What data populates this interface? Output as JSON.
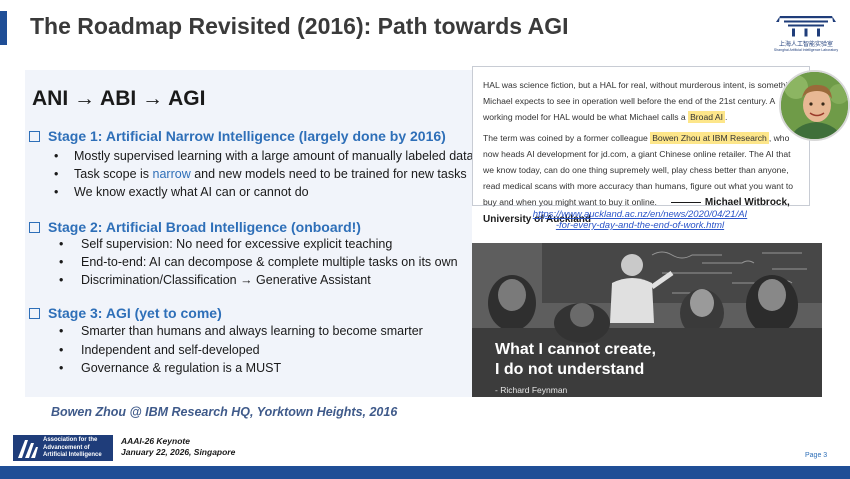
{
  "slide": {
    "title": "The Roadmap Revisited (2016): Path towards AGI",
    "page_label": "Page 3"
  },
  "logo_top_right": {
    "cn_text": "上海人工智能实验室",
    "en_text": "Shanghai Artificial Intelligence Laboratory"
  },
  "main": {
    "heading": "ANI → ABI → AGI",
    "stages": [
      {
        "title": "Stage 1: Artificial Narrow Intelligence (largely done by 2016)",
        "bullets": [
          "Mostly supervised learning with a large amount of manually labeled data",
          "Task scope is narrow and new models need to be trained for new tasks",
          "We know exactly what AI can or cannot do"
        ],
        "bullet2_parts": {
          "before": "Task scope is ",
          "highlight": "narrow",
          "after": " and new models need to be trained for new tasks"
        }
      },
      {
        "title": "Stage 2: Artificial Broad Intelligence (onboard!)",
        "bullets": [
          "Self supervision: No need for excessive explicit teaching",
          "End-to-end: AI can decompose & complete multiple tasks on its own",
          "Discrimination/Classification → Generative Assistant"
        ]
      },
      {
        "title": "Stage 3: AGI (yet to come)",
        "bullets": [
          "Smarter than humans and always learning to become smarter",
          "Independent and self-developed",
          "Governance & regulation is a MUST"
        ]
      }
    ]
  },
  "quote": {
    "p1_a": "HAL was science fiction, but a HAL for real, without murderous intent, is something Michael expects to see in operation well before the end of the 21st century. A working model for HAL would be what Michael calls a ",
    "p1_hl": "Broad AI",
    "p1_b": ".",
    "p2_a": "The term was coined by a former colleague ",
    "p2_hl": "Bowen Zhou at IBM Research",
    "p2_b": ", who now heads AI development for jd.com, a giant Chinese online retailer. The AI that we know today, can do one thing supremely well, play chess better than anyone, read medical scans with more accuracy than humans, figure out what you want to buy and when you might want to buy it online.",
    "attribution": "Michael Witbrock, University of Auckland"
  },
  "link": {
    "line1": "https://www.auckland.ac.nz/en/news/2020/04/21/AI",
    "line2": "-for-every-day-and-the-end-of-work.html"
  },
  "photo": {
    "quote_line1": "What I cannot create,",
    "quote_line2": "I do not understand",
    "attribution": "- Richard Feynman"
  },
  "caption": "Bowen Zhou @ IBM Research HQ, Yorktown Heights, 2016",
  "footer": {
    "org_name": "Association for the\nAdvancement of\nArtificial Intelligence",
    "event_line1": "AAAI-26 Keynote",
    "event_line2": "January 22, 2026, Singapore"
  },
  "colors": {
    "accent_blue": "#2e6fb8",
    "navy": "#1f4e96",
    "highlight": "#fde68a",
    "panel_bg": "#f1f4fa"
  }
}
